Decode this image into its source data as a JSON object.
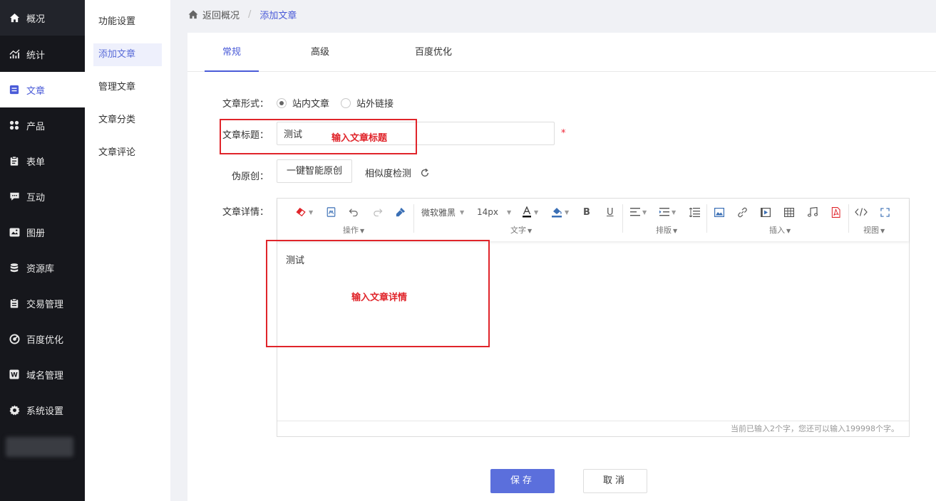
{
  "sidebar": {
    "items": [
      {
        "label": "概况",
        "icon": "home-icon"
      },
      {
        "label": "统计",
        "icon": "chart-icon"
      },
      {
        "label": "文章",
        "icon": "article-icon"
      },
      {
        "label": "产品",
        "icon": "grid-icon"
      },
      {
        "label": "表单",
        "icon": "clipboard-icon"
      },
      {
        "label": "互动",
        "icon": "chat-icon"
      },
      {
        "label": "图册",
        "icon": "album-icon"
      },
      {
        "label": "资源库",
        "icon": "database-icon"
      },
      {
        "label": "交易管理",
        "icon": "trade-icon"
      },
      {
        "label": "百度优化",
        "icon": "seo-icon"
      },
      {
        "label": "域名管理",
        "icon": "domain-icon"
      },
      {
        "label": "系统设置",
        "icon": "gear-icon"
      }
    ]
  },
  "subnav": {
    "items": [
      "功能设置",
      "添加文章",
      "管理文章",
      "文章分类",
      "文章评论"
    ]
  },
  "breadcrumb": {
    "back": "返回概况",
    "sep": "/",
    "current": "添加文章"
  },
  "tabs": [
    "常规",
    "高级",
    "百度优化"
  ],
  "form": {
    "type_label": "文章形式：",
    "type_options": [
      "站内文章",
      "站外链接"
    ],
    "title_label": "文章标题：",
    "title_value": "测试",
    "required_mark": "*",
    "pseudo_label": "伪原创：",
    "pseudo_button": "一键智能原创",
    "similarity_check": "相似度检测",
    "detail_label": "文章详情："
  },
  "editor": {
    "font_family": "微软雅黑",
    "font_size": "14px",
    "groups": [
      "操作",
      "文字",
      "排版",
      "插入",
      "视图"
    ],
    "content": "测试",
    "footer": "当前已输入2个字，您还可以输入199998个字。"
  },
  "annotations": {
    "title_hint": "输入文章标题",
    "detail_hint": "输入文章详情"
  },
  "actions": {
    "save": "保存",
    "cancel": "取消"
  },
  "colors": {
    "accent": "#4a5bd8",
    "primary_button": "#5b6fdc",
    "annotation": "#e0242a",
    "sidebar_bg": "#16171c"
  }
}
